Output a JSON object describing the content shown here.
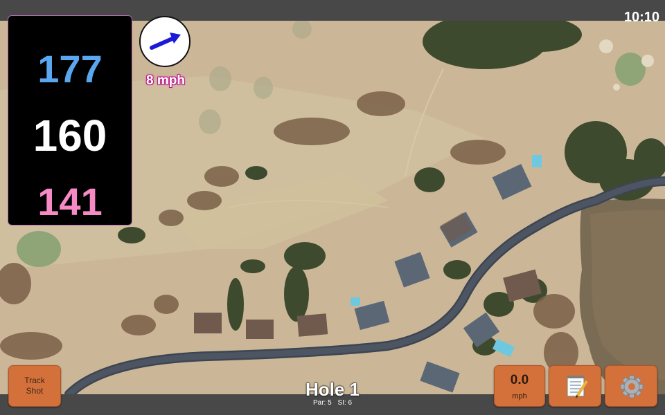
{
  "status": {
    "time": "10:10"
  },
  "yardage": {
    "back": "177",
    "center": "160",
    "front": "141"
  },
  "wind": {
    "speed_label": "8 mph",
    "direction_icon": "arrow-icon"
  },
  "hole": {
    "title": "Hole 1",
    "par": "Par: 5",
    "stroke_index": "SI: 6"
  },
  "buttons": {
    "track_shot_line1": "Track",
    "track_shot_line2": "Shot",
    "speed_value": "0.0",
    "speed_unit": "mph",
    "notes_icon": "notepad-icon",
    "settings_icon": "gear-icon"
  },
  "colors": {
    "back_yardage": "#5aa7f0",
    "center_yardage": "#ffffff",
    "front_yardage": "#f58ac4",
    "button_orange": "#d4713a",
    "wind_arrow": "#1a1ad8",
    "accent_magenta": "#c0198c"
  }
}
